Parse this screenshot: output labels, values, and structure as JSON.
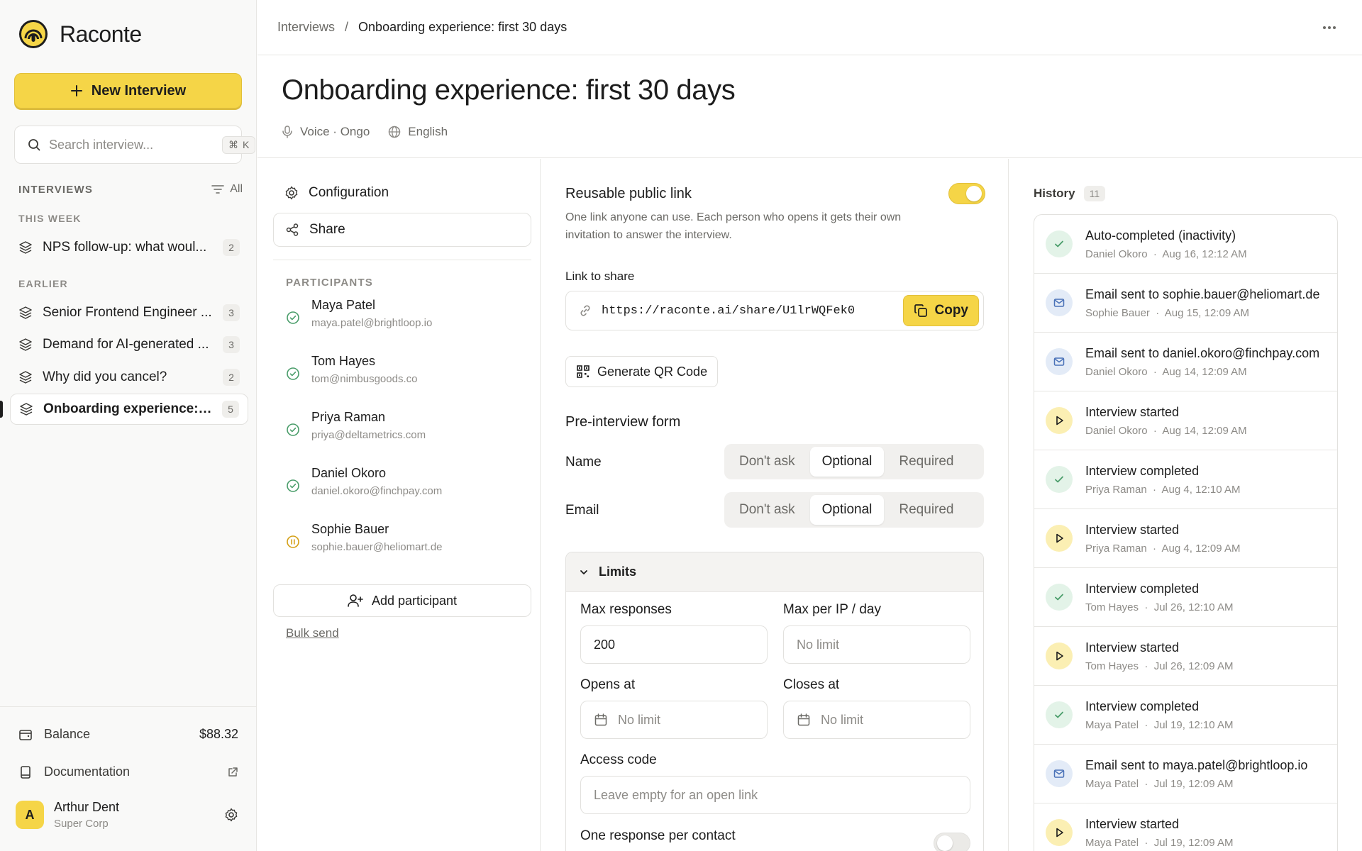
{
  "brand": {
    "name": "Raconte",
    "accent": "#f5d547"
  },
  "sidebar": {
    "new_interview": "New Interview",
    "search_placeholder": "Search interview...",
    "search_kbd_mod": "⌘",
    "search_kbd_key": "K",
    "section_title": "INTERVIEWS",
    "filter_label": "All",
    "groups": [
      {
        "label": "THIS WEEK"
      },
      {
        "label": "EARLIER"
      }
    ],
    "items": [
      {
        "label": "NPS follow-up: what woul...",
        "count": "2"
      },
      {
        "label": "Senior Frontend Engineer ...",
        "count": "3"
      },
      {
        "label": "Demand for AI-generated ...",
        "count": "3"
      },
      {
        "label": "Why did you cancel?",
        "count": "2"
      },
      {
        "label": "Onboarding experience: fi...",
        "count": "5",
        "active": true
      }
    ],
    "balance_label": "Balance",
    "balance_value": "$88.32",
    "docs_label": "Documentation",
    "user": {
      "initial": "A",
      "name": "Arthur Dent",
      "org": "Super Corp"
    }
  },
  "breadcrumb": {
    "parent": "Interviews",
    "separator": "/",
    "current": "Onboarding experience: first 30 days"
  },
  "page": {
    "title": "Onboarding experience: first 30 days",
    "voice": "Voice · Ongo",
    "language": "English"
  },
  "tabs": {
    "configuration": "Configuration",
    "share": "Share"
  },
  "participants": {
    "header": "PARTICIPANTS",
    "list": [
      {
        "name": "Maya Patel",
        "email": "maya.patel@brightloop.io",
        "status": "completed"
      },
      {
        "name": "Tom Hayes",
        "email": "tom@nimbusgoods.co",
        "status": "completed"
      },
      {
        "name": "Priya Raman",
        "email": "priya@deltametrics.com",
        "status": "completed"
      },
      {
        "name": "Daniel Okoro",
        "email": "daniel.okoro@finchpay.com",
        "status": "completed"
      },
      {
        "name": "Sophie Bauer",
        "email": "sophie.bauer@heliomart.de",
        "status": "paused"
      }
    ],
    "add_label": "Add participant",
    "bulk_label": "Bulk send"
  },
  "share": {
    "reusable_title": "Reusable public link",
    "reusable_desc": "One link anyone can use. Each person who opens it gets their own invitation to answer the interview.",
    "reusable_enabled": true,
    "link_label": "Link to share",
    "link_url": "https://raconte.ai/share/U1lrWQFek0",
    "copy_label": "Copy",
    "qr_label": "Generate QR Code",
    "form_title": "Pre-interview form",
    "form_rows": [
      {
        "label": "Name",
        "options": [
          "Don't ask",
          "Optional",
          "Required"
        ],
        "selected": "Optional"
      },
      {
        "label": "Email",
        "options": [
          "Don't ask",
          "Optional",
          "Required"
        ],
        "selected": "Optional"
      }
    ],
    "limits": {
      "title": "Limits",
      "max_responses_label": "Max responses",
      "max_responses_value": "200",
      "max_per_ip_label": "Max per IP / day",
      "max_per_ip_placeholder": "No limit",
      "opens_label": "Opens at",
      "opens_value": "No limit",
      "closes_label": "Closes at",
      "closes_value": "No limit",
      "access_label": "Access code",
      "access_placeholder": "Leave empty for an open link",
      "one_response_label": "One response per contact",
      "one_response_enabled": false
    }
  },
  "history": {
    "title": "History",
    "count": "11",
    "items": [
      {
        "title": "Auto-completed (inactivity)",
        "who": "Daniel Okoro",
        "when": "Aug 16, 12:12 AM",
        "kind": "check"
      },
      {
        "title": "Email sent to sophie.bauer@heliomart.de",
        "who": "Sophie Bauer",
        "when": "Aug 15, 12:09 AM",
        "kind": "mail"
      },
      {
        "title": "Email sent to daniel.okoro@finchpay.com",
        "who": "Daniel Okoro",
        "when": "Aug 14, 12:09 AM",
        "kind": "mail"
      },
      {
        "title": "Interview started",
        "who": "Daniel Okoro",
        "when": "Aug 14, 12:09 AM",
        "kind": "play"
      },
      {
        "title": "Interview completed",
        "who": "Priya Raman",
        "when": "Aug 4, 12:10 AM",
        "kind": "check"
      },
      {
        "title": "Interview started",
        "who": "Priya Raman",
        "when": "Aug 4, 12:09 AM",
        "kind": "play"
      },
      {
        "title": "Interview completed",
        "who": "Tom Hayes",
        "when": "Jul 26, 12:10 AM",
        "kind": "check"
      },
      {
        "title": "Interview started",
        "who": "Tom Hayes",
        "when": "Jul 26, 12:09 AM",
        "kind": "play"
      },
      {
        "title": "Interview completed",
        "who": "Maya Patel",
        "when": "Jul 19, 12:10 AM",
        "kind": "check"
      },
      {
        "title": "Email sent to maya.patel@brightloop.io",
        "who": "Maya Patel",
        "when": "Jul 19, 12:09 AM",
        "kind": "mail"
      },
      {
        "title": "Interview started",
        "who": "Maya Patel",
        "when": "Jul 19, 12:09 AM",
        "kind": "play"
      }
    ]
  }
}
